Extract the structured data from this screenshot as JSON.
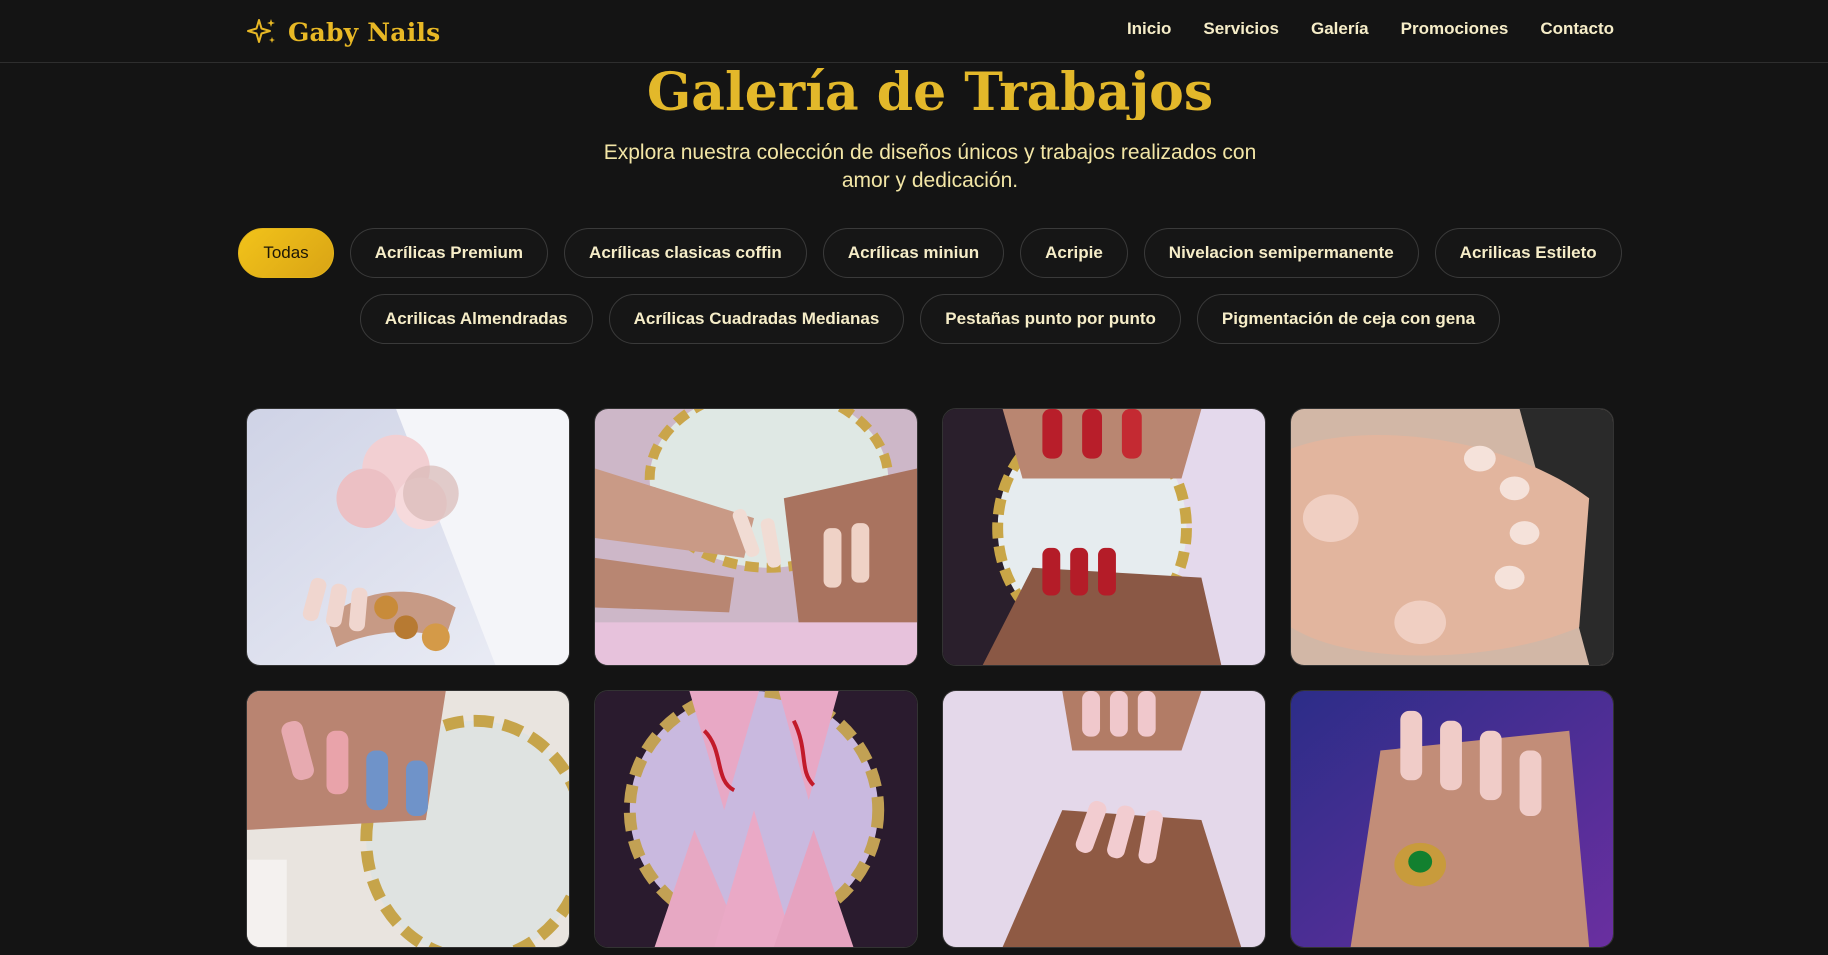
{
  "brand": {
    "name": "Gaby Nails",
    "icon": "sparkles-icon",
    "accent": "#e8b825"
  },
  "nav": [
    {
      "label": "Inicio"
    },
    {
      "label": "Servicios"
    },
    {
      "label": "Galería"
    },
    {
      "label": "Promociones"
    },
    {
      "label": "Contacto"
    }
  ],
  "hero": {
    "title": "Galería de Trabajos",
    "subtitle": "Explora nuestra colección de diseños únicos y trabajos realizados con amor y dedicación."
  },
  "filters": {
    "active": "Todas",
    "items": [
      "Todas",
      "Acrílicas Premium",
      "Acrílicas clasicas coffin",
      "Acrílicas miniun",
      "Acripie",
      "Nivelacion semipermanente",
      "Acrilicas Estileto",
      "Acrilicas Almendradas",
      "Acrílicas Cuadradas Medianas",
      "Pestañas punto por punto",
      "Pigmentación de ceja con gena"
    ]
  },
  "colors": {
    "background": "#141414",
    "gold": "#e3b82a",
    "pill_active": "#f2c31a",
    "text_light": "#f6edc8"
  }
}
